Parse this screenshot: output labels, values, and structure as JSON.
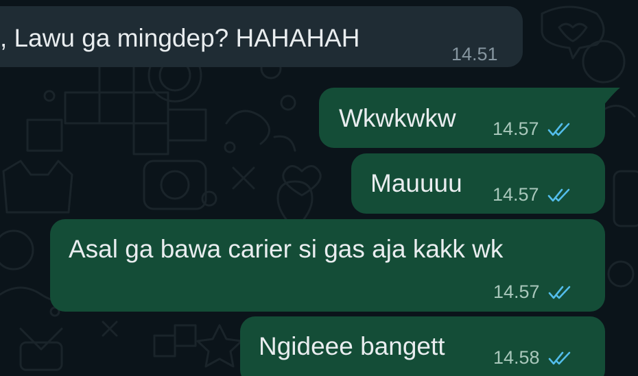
{
  "messages": [
    {
      "direction": "incoming",
      "text": ", Lawu ga mingdep? HAHAHAH",
      "time": "14.51"
    },
    {
      "direction": "outgoing",
      "text": "Wkwkwkw",
      "time": "14.57",
      "status": "read"
    },
    {
      "direction": "outgoing",
      "text": "Mauuuu",
      "time": "14.57",
      "status": "read"
    },
    {
      "direction": "outgoing",
      "text": "Asal ga bawa carier si gas aja kakk wk",
      "time": "14.57",
      "status": "read"
    },
    {
      "direction": "outgoing",
      "text": "Ngideee bangett",
      "time": "14.58",
      "status": "read"
    }
  ],
  "colors": {
    "background": "#0b141a",
    "incoming_bubble": "#1f2c34",
    "outgoing_bubble": "#144d37",
    "read_tick": "#53bdeb",
    "text": "#e9edef"
  },
  "icons": {
    "read_receipt": "double-check-icon"
  }
}
